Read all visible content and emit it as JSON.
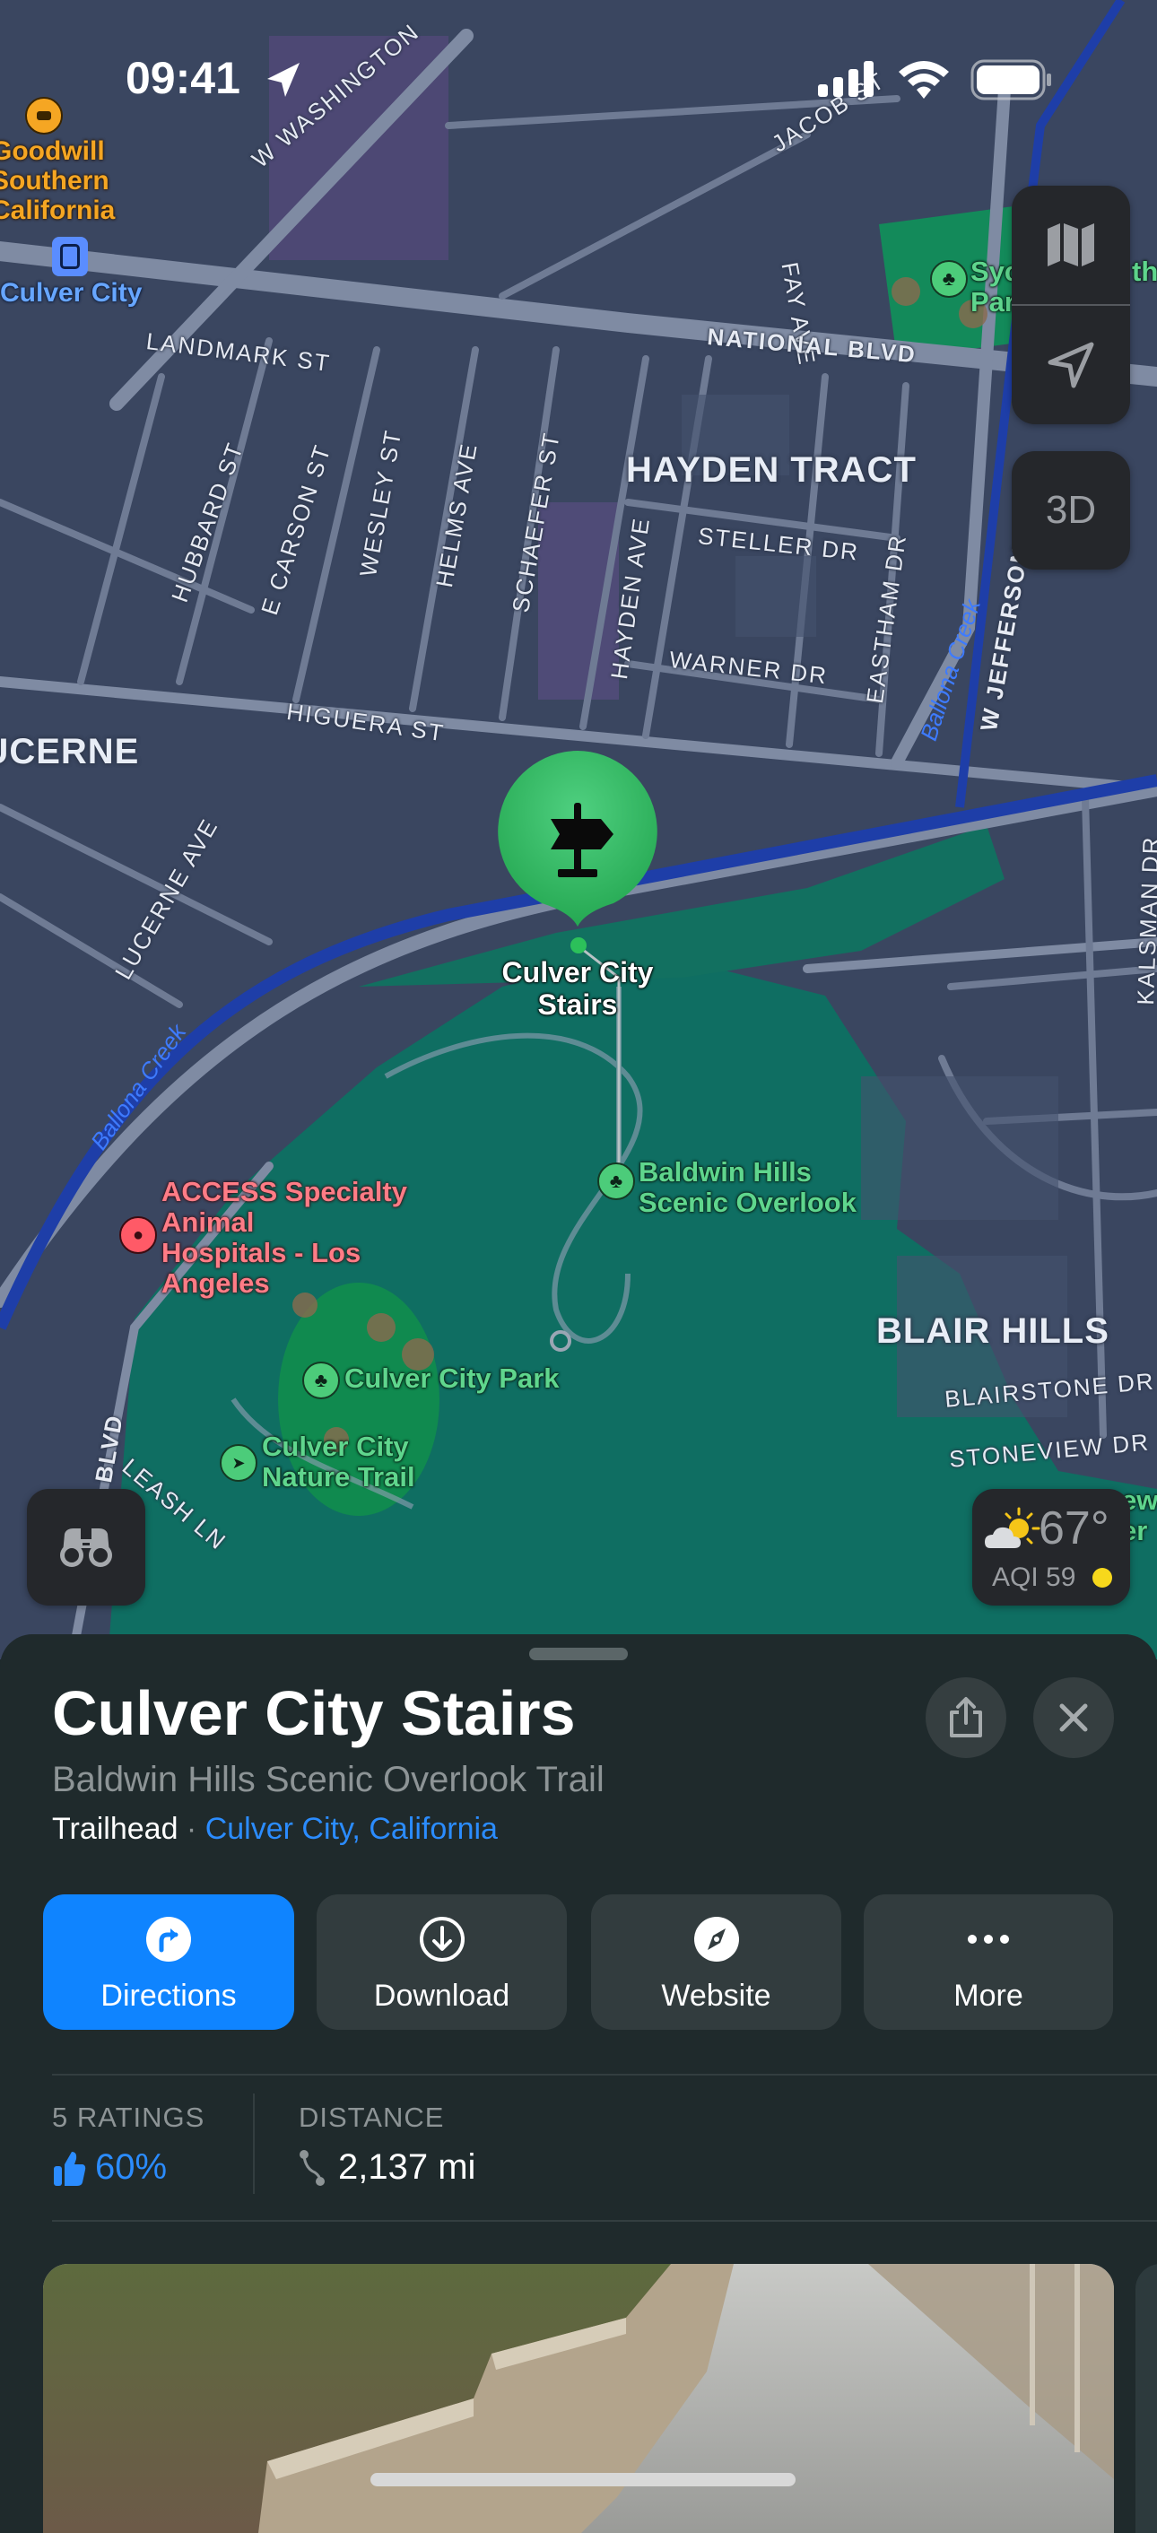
{
  "status_bar": {
    "time": "09:41",
    "icons": [
      "location-arrow-icon",
      "cellular-signal-icon",
      "wifi-icon",
      "battery-icon"
    ]
  },
  "map": {
    "neighborhoods": [
      "HAYDEN TRACT",
      "LUCERNE",
      "BLAIR HILLS"
    ],
    "streets": {
      "w_washington": "W WASHINGTON",
      "jacob": "JACOB ST",
      "fay_ave": "FAY AVE",
      "national_blvd": "NATIONAL BLVD",
      "landmark_st": "LANDMARK ST",
      "hubbard_st": "HUBBARD ST",
      "e_carson_st": "E CARSON ST",
      "wesley_st": "WESLEY ST",
      "helms_ave": "HELMS AVE",
      "schaefer_st": "SCHAEFER ST",
      "hayden_ave": "HAYDEN AVE",
      "steller_dr": "STELLER DR",
      "warner_dr": "WARNER DR",
      "eastham_dr": "EASTHAM DR",
      "w_jefferson_blvd": "W JEFFERSON BLVD",
      "higuera_st": "HIGUERA ST",
      "lucerne_ave": "LUCERNE AVE",
      "kalsman_dr": "KALSMAN DR",
      "blairstone_dr": "BLAIRSTONE DR",
      "stoneview_dr": "STONEVIEW DR",
      "leash_ln": "LEASH LN",
      "blvd": "BLVD"
    },
    "waterways": [
      "Ballona Creek",
      "Ballona Creek"
    ],
    "pois": {
      "goodwill": "Goodwill\nSouthern\nCalifornia",
      "culver_city_station": "Culver City",
      "sycamore_park": "Syc\nPar",
      "sycamore_park_right": "th",
      "selected_pin": "Culver City\nStairs",
      "baldwin_overlook": "Baldwin Hills\nScenic Overlook",
      "access_specialty": "ACCESS Specialty\nAnimal\nHospitals - Los\nAngeles",
      "culver_city_park": "Culver City Park",
      "nature_trail": "Culver City\nNature Trail",
      "edge_right": "ew\ner"
    },
    "controls": {
      "map_mode": "map-icon",
      "location": "location-arrow-icon",
      "three_d_label": "3D",
      "look_around": "binoculars-icon"
    },
    "weather": {
      "temperature": "67°",
      "aqi_label": "AQI 59",
      "aqi_color": "#f7d81c",
      "condition_icon": "partly-cloudy-icon"
    }
  },
  "sheet": {
    "title": "Culver City Stairs",
    "subtitle": "Baldwin Hills Scenic Overlook Trail",
    "category": "Trailhead",
    "separator": " · ",
    "location_link": "Culver City, California",
    "actions": [
      {
        "label": "Directions",
        "icon": "turn-right-icon",
        "primary": true
      },
      {
        "label": "Download",
        "icon": "download-icon",
        "primary": false
      },
      {
        "label": "Website",
        "icon": "compass-icon",
        "primary": false
      },
      {
        "label": "More",
        "icon": "ellipsis-icon",
        "primary": false
      }
    ],
    "ratings": {
      "label": "5 RATINGS",
      "value": "60%"
    },
    "distance": {
      "label": "DISTANCE",
      "value": "2,137 mi"
    },
    "accent_color": "#0f84ff"
  }
}
